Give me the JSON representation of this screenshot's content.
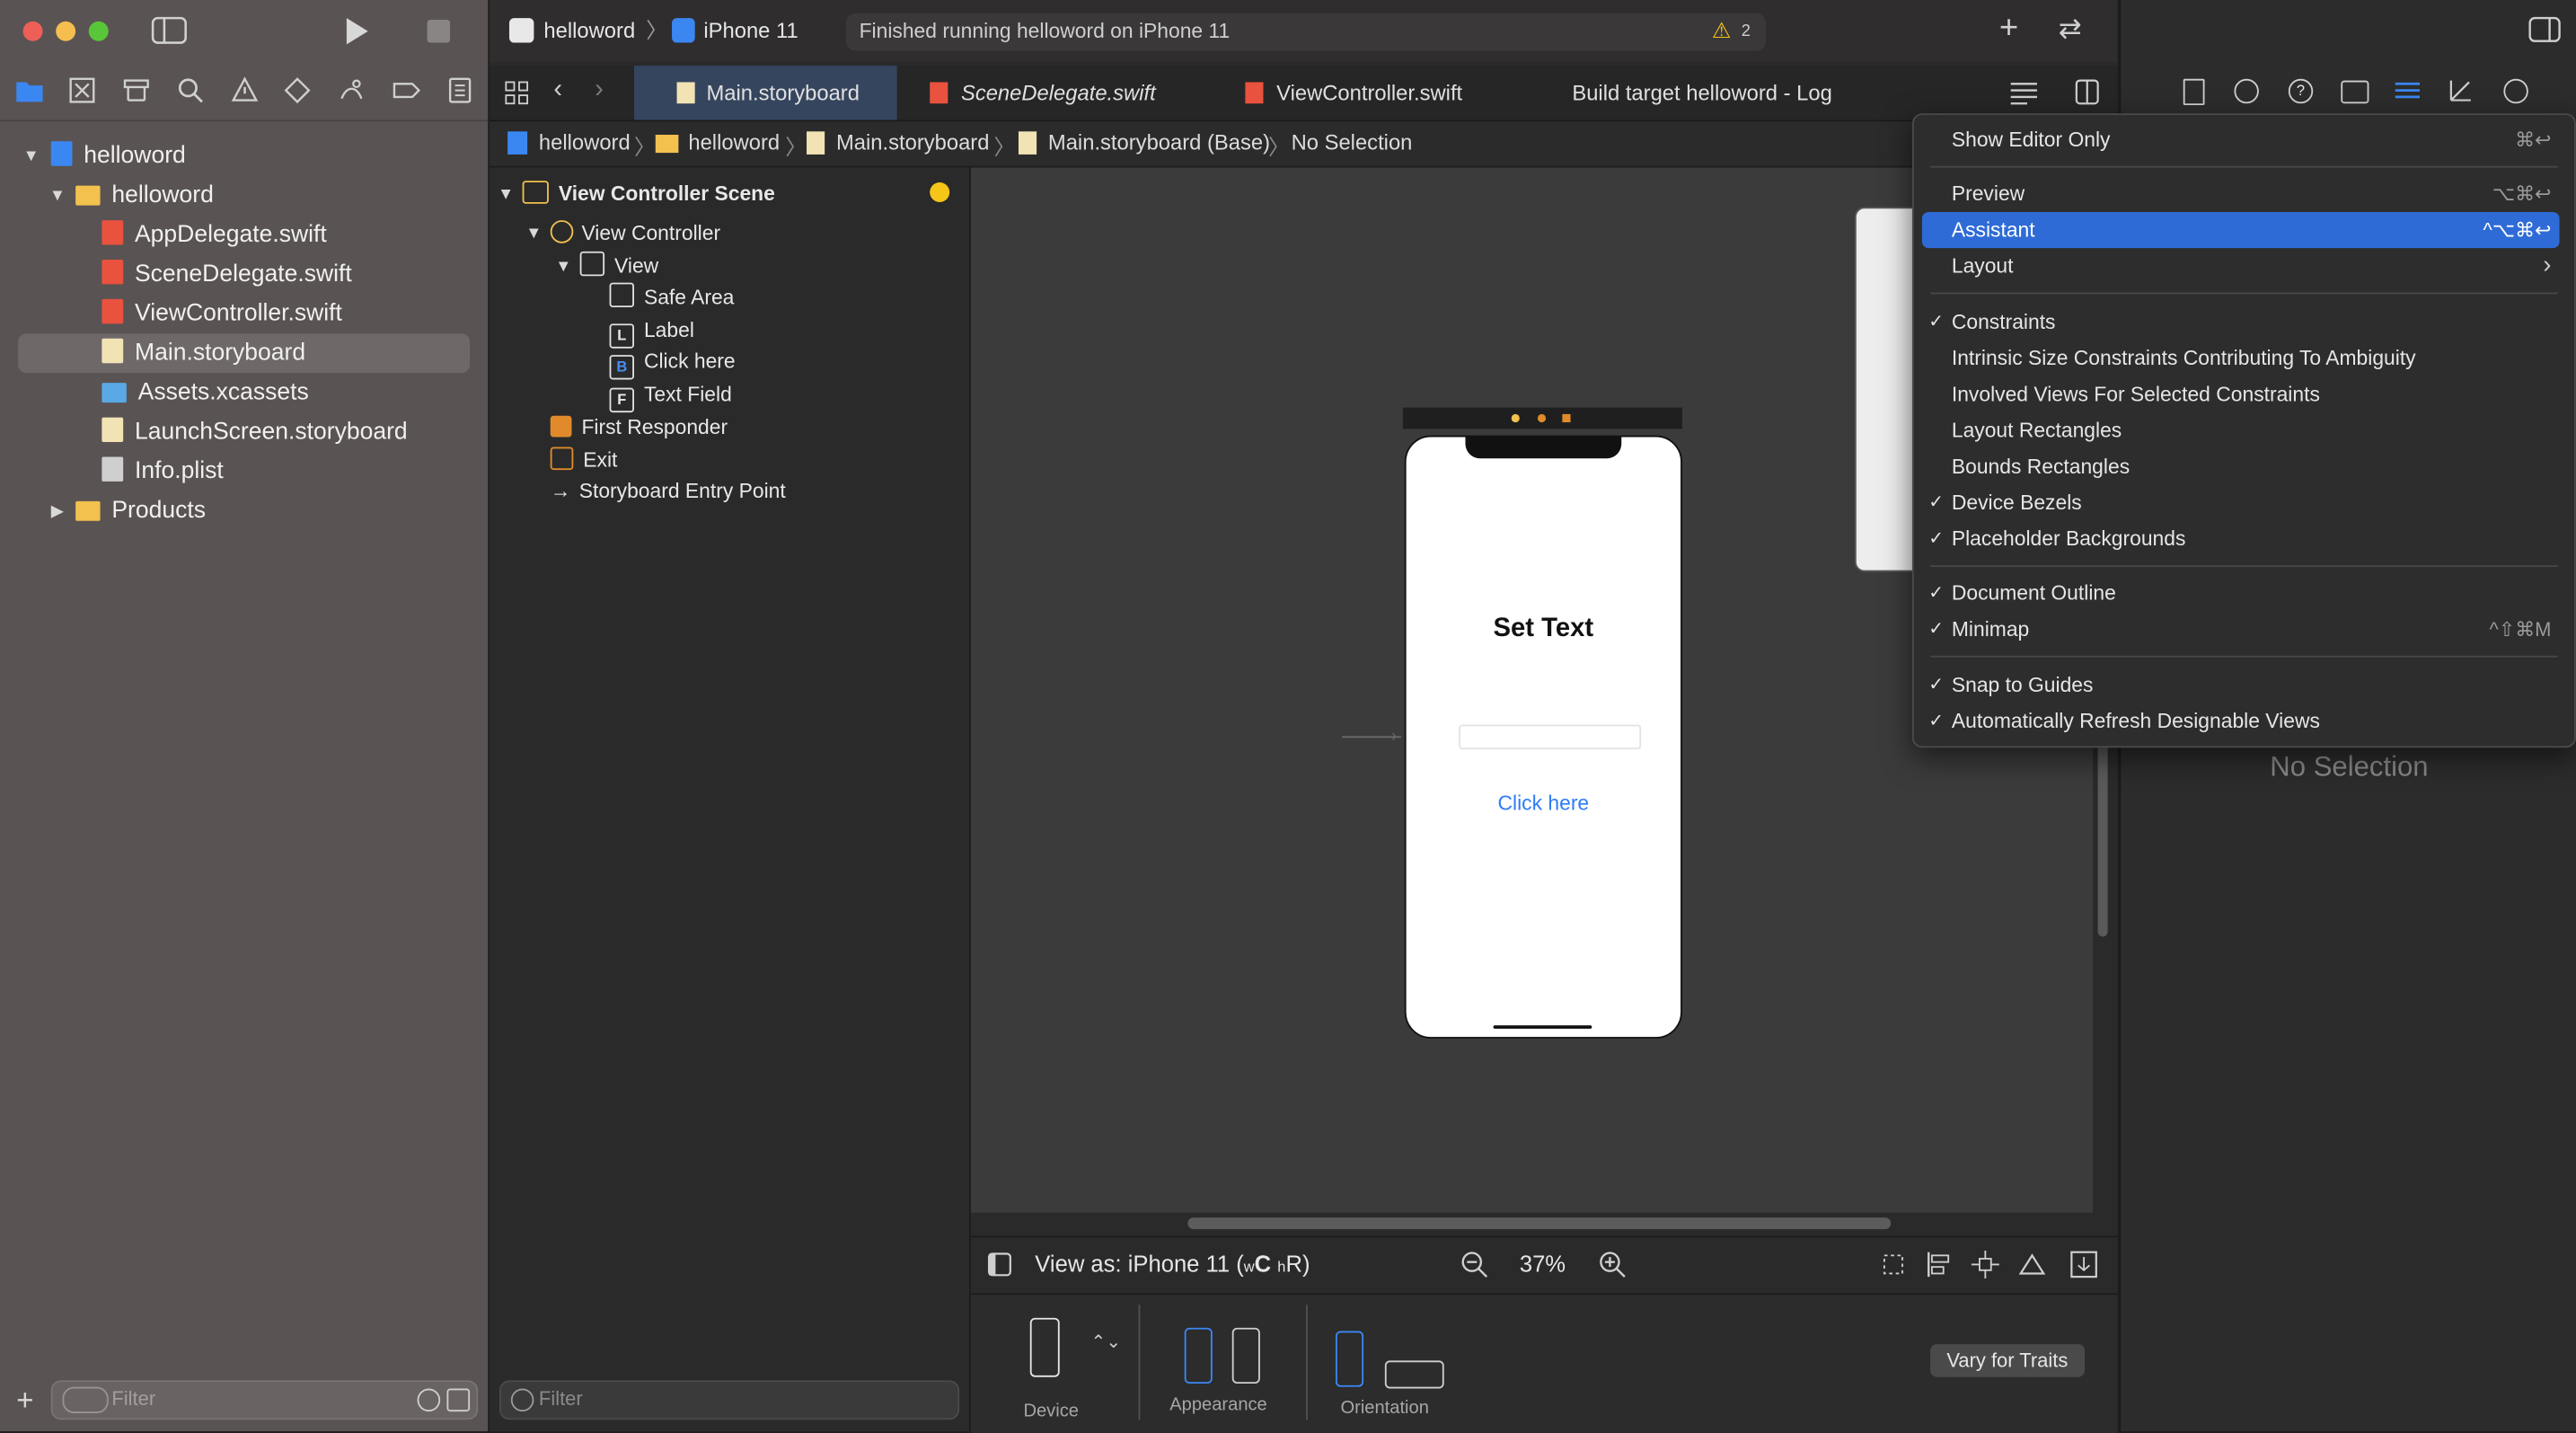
{
  "window": {
    "scheme_project": "helloword",
    "scheme_device": "iPhone 11",
    "activity_status": "Finished running helloword on iPhone 11",
    "warning_count": "2"
  },
  "navigator": {
    "items": [
      {
        "label": "helloword"
      },
      {
        "label": "helloword"
      },
      {
        "label": "AppDelegate.swift"
      },
      {
        "label": "SceneDelegate.swift"
      },
      {
        "label": "ViewController.swift"
      },
      {
        "label": "Main.storyboard"
      },
      {
        "label": "Assets.xcassets"
      },
      {
        "label": "LaunchScreen.storyboard"
      },
      {
        "label": "Info.plist"
      },
      {
        "label": "Products"
      }
    ],
    "filter_placeholder": "Filter"
  },
  "tabs": [
    {
      "label": "Main.storyboard"
    },
    {
      "label": "SceneDelegate.swift"
    },
    {
      "label": "ViewController.swift"
    },
    {
      "label": "Build target helloword - Log"
    }
  ],
  "jumpbar": [
    "helloword",
    "helloword",
    "Main.storyboard",
    "Main.storyboard (Base)",
    "No Selection"
  ],
  "outline": {
    "items": [
      {
        "label": "View Controller Scene"
      },
      {
        "label": "View Controller"
      },
      {
        "label": "View"
      },
      {
        "label": "Safe Area",
        "badge": ""
      },
      {
        "label": "Label",
        "badge": "L"
      },
      {
        "label": "Click here",
        "badge": "B"
      },
      {
        "label": "Text Field",
        "badge": "F"
      },
      {
        "label": "First Responder"
      },
      {
        "label": "Exit"
      },
      {
        "label": "Storyboard Entry Point"
      }
    ],
    "filter_placeholder": "Filter"
  },
  "canvas": {
    "title_label": "Set Text",
    "button_label": "Click here"
  },
  "bottombar": {
    "view_as_prefix": "View as: iPhone 11 (",
    "view_as_w": "w",
    "view_as_c": "C",
    "view_as_h": "h",
    "view_as_r": "R)",
    "zoom": "37%"
  },
  "devicebar": {
    "device_label": "Device",
    "appearance_label": "Appearance",
    "orientation_label": "Orientation",
    "vary_button": "Vary for Traits"
  },
  "inspector": {
    "no_selection": "No Selection"
  },
  "menu": {
    "items": [
      {
        "label": "Show Editor Only",
        "shortcut": "⌘↩",
        "checked": false
      },
      {
        "label": "Preview",
        "shortcut": "⌥⌘↩",
        "checked": false
      },
      {
        "label": "Assistant",
        "shortcut": "^⌥⌘↩",
        "checked": false,
        "selected": true
      },
      {
        "label": "Layout",
        "shortcut": "›",
        "checked": false
      },
      {
        "label": "Constraints",
        "shortcut": "",
        "checked": true
      },
      {
        "label": "Intrinsic Size Constraints Contributing To Ambiguity",
        "shortcut": "",
        "checked": false
      },
      {
        "label": "Involved Views For Selected Constraints",
        "shortcut": "",
        "checked": false
      },
      {
        "label": "Layout Rectangles",
        "shortcut": "",
        "checked": false
      },
      {
        "label": "Bounds Rectangles",
        "shortcut": "",
        "checked": false
      },
      {
        "label": "Device Bezels",
        "shortcut": "",
        "checked": true
      },
      {
        "label": "Placeholder Backgrounds",
        "shortcut": "",
        "checked": true
      },
      {
        "label": "Document Outline",
        "shortcut": "",
        "checked": true
      },
      {
        "label": "Minimap",
        "shortcut": "^⇧⌘M",
        "checked": true
      },
      {
        "label": "Snap to Guides",
        "shortcut": "",
        "checked": true
      },
      {
        "label": "Automatically Refresh Designable Views",
        "shortcut": "",
        "checked": true
      }
    ],
    "checkmark": "✓"
  },
  "colors": {
    "accent": "#2e6bd6",
    "link": "#2e7cf6",
    "swift_file": "#e8523f",
    "folder": "#f2c14e",
    "warning": "#f5c518"
  }
}
